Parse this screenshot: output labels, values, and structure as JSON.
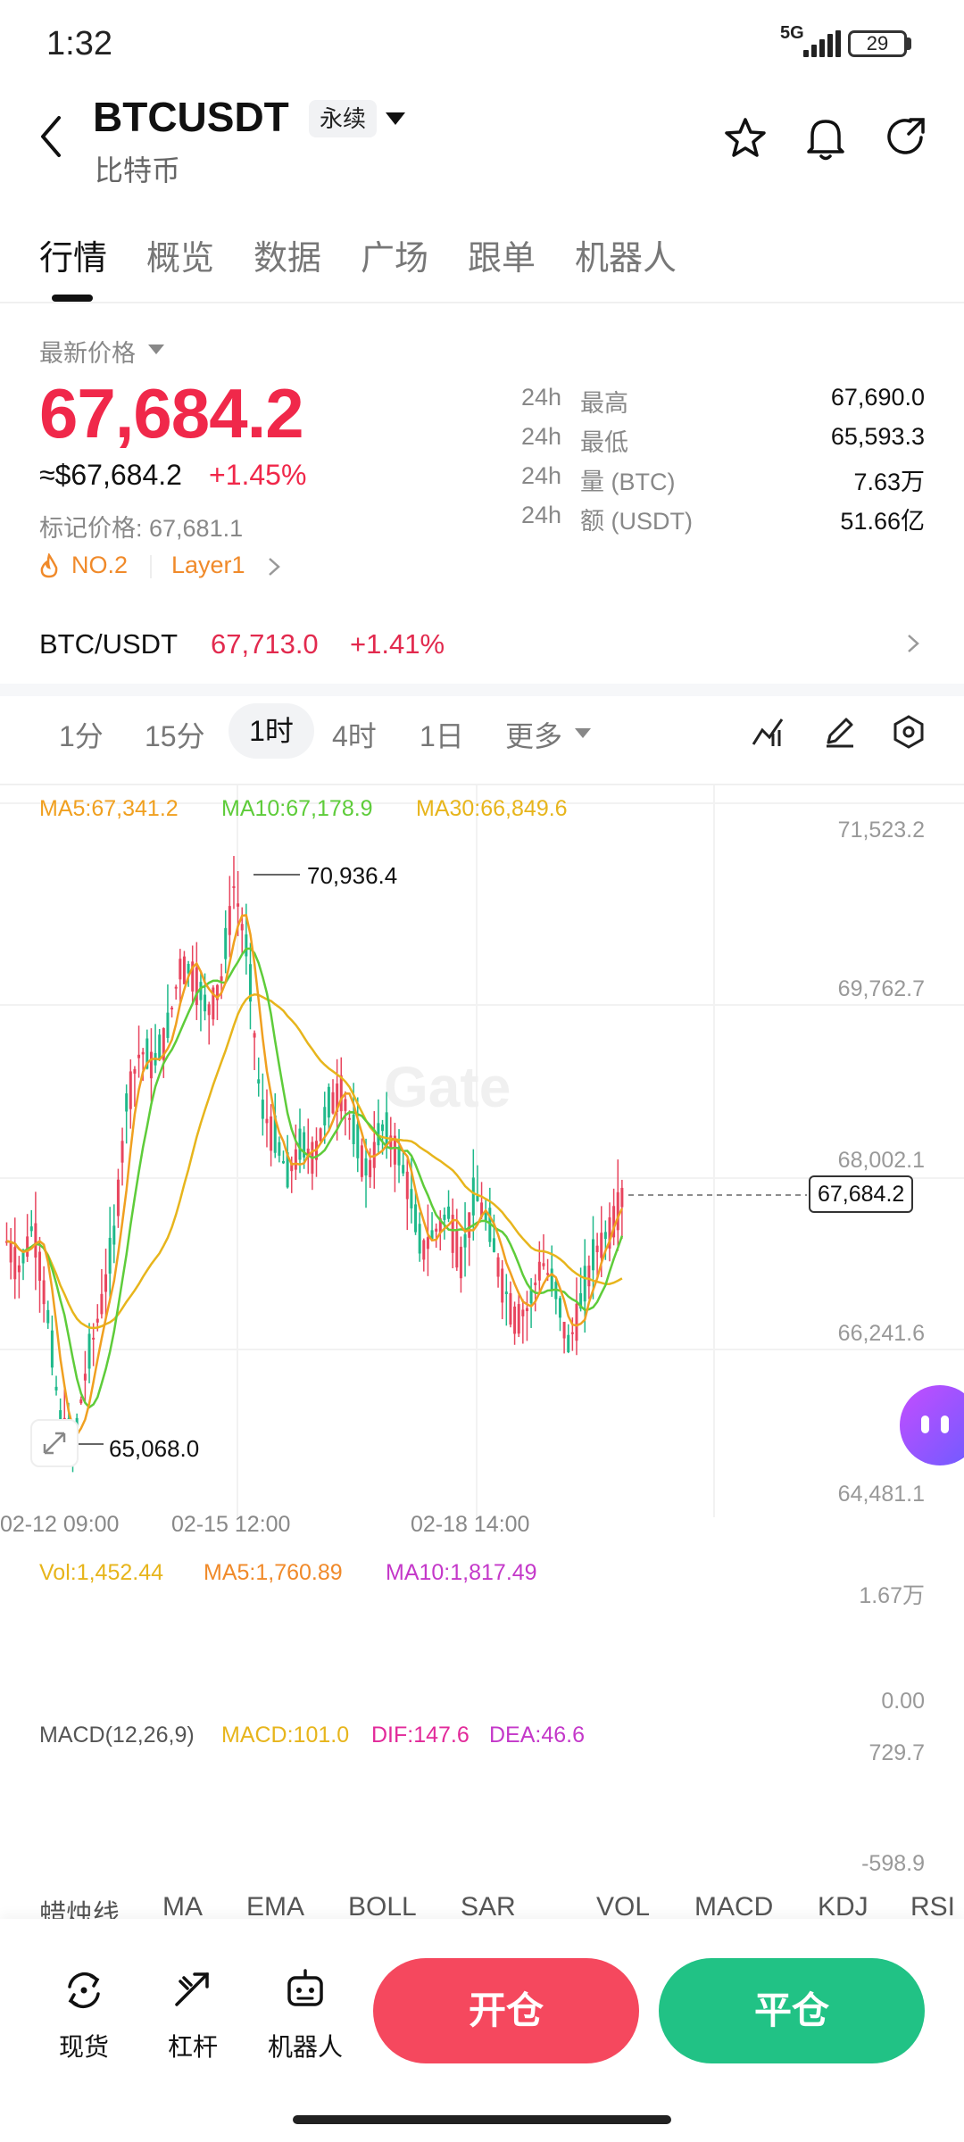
{
  "status": {
    "time": "1:32",
    "network": "5G",
    "battery": "29"
  },
  "header": {
    "title": "BTCUSDT",
    "badge": "永续",
    "subtitle": "比特币"
  },
  "tabs": [
    "行情",
    "概览",
    "数据",
    "广场",
    "跟单",
    "机器人"
  ],
  "price": {
    "label": "最新价格",
    "last": "67,684.2",
    "approx": "≈$67,684.2",
    "change": "+1.45%",
    "mark": "标记价格: 67,681.1",
    "rank": "NO.2",
    "sector": "Layer1"
  },
  "stats": [
    {
      "k1": "24h",
      "k2": "最高",
      "v": "67,690.0"
    },
    {
      "k1": "24h",
      "k2": "最低",
      "v": "65,593.3"
    },
    {
      "k1": "24h",
      "k2": "量 (BTC)",
      "v": "7.63万"
    },
    {
      "k1": "24h",
      "k2": "额 (USDT)",
      "v": "51.66亿"
    }
  ],
  "spot": {
    "name": "BTC/USDT",
    "price": "67,713.0",
    "change": "+1.41%"
  },
  "intervals": [
    "1分",
    "15分",
    "1时",
    "4时",
    "1日",
    "更多"
  ],
  "active_interval": "1时",
  "ma_legend": {
    "ma5": "MA5:67,341.2",
    "ma10": "MA10:67,178.9",
    "ma30": "MA30:66,849.6"
  },
  "price_axis": [
    "71,523.2",
    "69,762.7",
    "68,002.1",
    "66,241.6",
    "64,481.1"
  ],
  "time_axis": [
    "02-12 09:00",
    "02-15 12:00",
    "02-18 14:00"
  ],
  "annotations": {
    "high": "70,936.4",
    "low": "65,068.0",
    "current": "67,684.2"
  },
  "vol_legend": {
    "vol": "Vol:1,452.44",
    "ma5": "MA5:1,760.89",
    "ma10": "MA10:1,817.49"
  },
  "vol_axis": [
    "1.67万",
    "0.00"
  ],
  "macd_legend": {
    "name": "MACD(12,26,9)",
    "macd": "MACD:101.0",
    "dif": "DIF:147.6",
    "dea": "DEA:46.6"
  },
  "macd_axis": [
    "729.7",
    "-598.9"
  ],
  "indicator_tabs": [
    "蜡烛线",
    "MA",
    "EMA",
    "BOLL",
    "SAR",
    "VOL",
    "MACD",
    "KDJ",
    "RSI"
  ],
  "bottom_nav": [
    "现货",
    "杠杆",
    "机器人"
  ],
  "actions": {
    "open": "开仓",
    "close": "平仓"
  },
  "chart_data": {
    "type": "candlestick",
    "y_range": [
      64481.1,
      71523.2
    ],
    "price_close_series": [
      67200,
      66900,
      67400,
      66500,
      65300,
      65068,
      65900,
      66500,
      67200,
      68700,
      69200,
      69050,
      69400,
      70100,
      70000,
      69600,
      69900,
      70936.4,
      70200,
      68600,
      68300,
      67900,
      68200,
      68100,
      68600,
      68800,
      68300,
      67900,
      68400,
      68200,
      67800,
      67100,
      67300,
      67500,
      67000,
      67700,
      67400,
      66800,
      66400,
      66500,
      67000,
      66700,
      66100,
      66600,
      67100,
      67300,
      67684.2
    ],
    "colors": {
      "up": "#e8455e",
      "down": "#1fb98a",
      "ma5": "#f0a020",
      "ma10": "#5ecc3a",
      "ma30": "#e7b51c"
    }
  }
}
